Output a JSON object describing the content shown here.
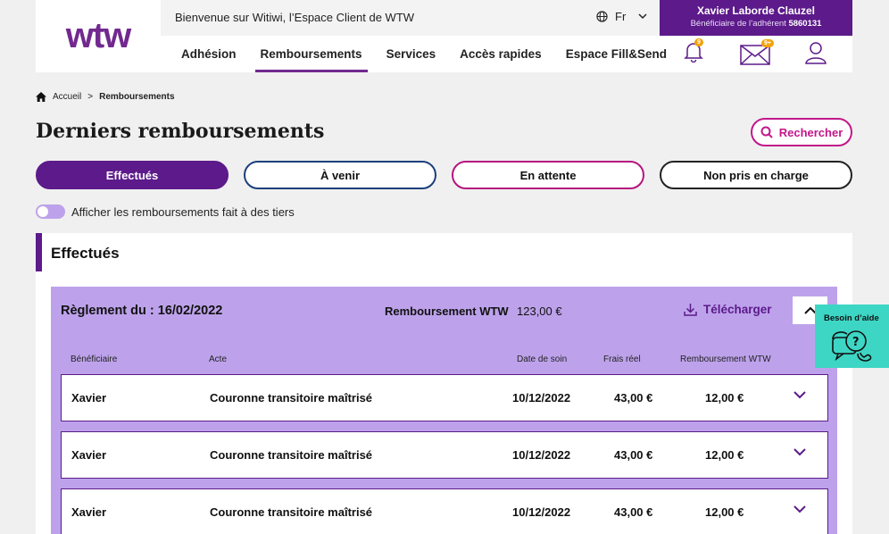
{
  "brand": {
    "logo_text": "wtw",
    "accent": "#5c1a8a",
    "pink": "#c2178a",
    "card_bg": "#bda2eb"
  },
  "topbar": {
    "welcome": "Bienvenue sur Witiwi, l’Espace Client de WTW",
    "language": "Fr",
    "user_name": "Xavier Laborde Clauzel",
    "user_sub_prefix": "Bénéficiaire de l’adhérent",
    "user_id": "5860131"
  },
  "nav": {
    "items": [
      {
        "label": "Adhésion"
      },
      {
        "label": "Remboursements"
      },
      {
        "label": "Services"
      },
      {
        "label": "Accès rapides"
      },
      {
        "label": "Espace Fill&Send"
      }
    ],
    "active_index": 1,
    "notif_badge": "9",
    "mail_badge": "9+"
  },
  "breadcrumb": {
    "home": "Accueil",
    "separator": ">",
    "current": "Remboursements"
  },
  "page": {
    "title": "Derniers remboursements",
    "search_label": "Rechercher"
  },
  "filters": [
    {
      "label": "Effectués"
    },
    {
      "label": "À venir"
    },
    {
      "label": "En attente"
    },
    {
      "label": "Non pris en charge"
    }
  ],
  "toggle": {
    "label": "Afficher les remboursements fait à des tiers"
  },
  "panel": {
    "title": "Effectués",
    "card": {
      "date_label": "Règlement du : 16/02/2022",
      "remb_label": "Remboursement WTW",
      "remb_amount": "123,00 €",
      "download_label": "Télécharger",
      "columns": [
        "Bénéficiaire",
        "Acte",
        "Date de soin",
        "Frais réel",
        "Remboursement WTW"
      ],
      "rows": [
        {
          "beneficiaire": "Xavier",
          "acte": "Couronne transitoire maîtrisé",
          "date": "10/12/2022",
          "frais": "43,00 €",
          "remboursement": "12,00 €"
        },
        {
          "beneficiaire": "Xavier",
          "acte": "Couronne transitoire maîtrisé",
          "date": "10/12/2022",
          "frais": "43,00 €",
          "remboursement": "12,00 €"
        },
        {
          "beneficiaire": "Xavier",
          "acte": "Couronne transitoire maîtrisé",
          "date": "10/12/2022",
          "frais": "43,00 €",
          "remboursement": "12,00 €"
        }
      ]
    }
  },
  "help": {
    "label": "Besoin d’aide"
  }
}
